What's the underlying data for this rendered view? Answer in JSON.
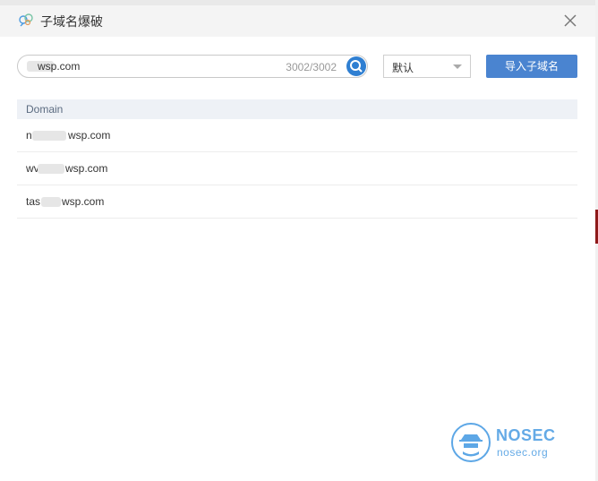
{
  "dialog": {
    "title": "子域名爆破",
    "title_icon": "brain-icon",
    "close_icon": "close-icon"
  },
  "search": {
    "value": "wsp.com",
    "count": "3002/3002",
    "icon": "search-icon"
  },
  "select": {
    "selected": "默认"
  },
  "import_button": {
    "label": "导入子域名"
  },
  "table": {
    "header": "Domain",
    "rows": [
      {
        "prefix": "n",
        "suffix": "wsp.com"
      },
      {
        "prefix": "wv",
        "suffix": "wsp.com"
      },
      {
        "prefix": "tas",
        "suffix": "wsp.com"
      }
    ]
  },
  "watermark": {
    "title": "NOSEC",
    "subtitle": "nosec.org"
  },
  "colors": {
    "accent": "#4a84d0",
    "search_button": "#2f7fd2",
    "header_bg": "#eef1f6",
    "watermark": "#64aae6"
  }
}
